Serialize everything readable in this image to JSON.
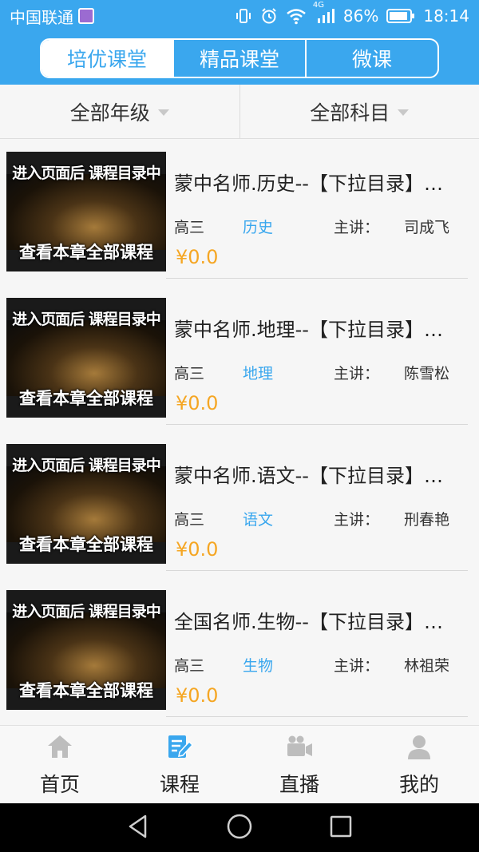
{
  "status_bar": {
    "carrier": "中国联通",
    "network": "4G",
    "battery": "86%",
    "time": "18:14"
  },
  "top_tabs": [
    {
      "label": "培优课堂",
      "active": true
    },
    {
      "label": "精品课堂",
      "active": false
    },
    {
      "label": "微课",
      "active": false
    }
  ],
  "filters": {
    "grade": "全部年级",
    "subject": "全部科目"
  },
  "courses": [
    {
      "thumb_line1": "进入页面后 课程目录中",
      "thumb_line2": "查看本章全部课程",
      "title": "蒙中名师.历史--【下拉目录】点击进入",
      "grade": "高三",
      "subject": "历史",
      "lecturer_label": "主讲：",
      "lecturer": "司成飞",
      "price": "¥0.0"
    },
    {
      "thumb_line1": "进入页面后 课程目录中",
      "thumb_line2": "查看本章全部课程",
      "title": "蒙中名师.地理--【下拉目录】点击进入",
      "grade": "高三",
      "subject": "地理",
      "lecturer_label": "主讲：",
      "lecturer": "陈雪松",
      "price": "¥0.0"
    },
    {
      "thumb_line1": "进入页面后 课程目录中",
      "thumb_line2": "查看本章全部课程",
      "title": "蒙中名师.语文--【下拉目录】点击进入",
      "grade": "高三",
      "subject": "语文",
      "lecturer_label": "主讲：",
      "lecturer": "刑春艳",
      "price": "¥0.0"
    },
    {
      "thumb_line1": "进入页面后 课程目录中",
      "thumb_line2": "查看本章全部课程",
      "title": "全国名师.生物--【下拉目录】点击进入",
      "grade": "高三",
      "subject": "生物",
      "lecturer_label": "主讲：",
      "lecturer": "林祖荣",
      "price": "¥0.0"
    }
  ],
  "bottom_nav": [
    {
      "label": "首页",
      "icon": "home-icon",
      "active": false
    },
    {
      "label": "课程",
      "icon": "course-icon",
      "active": true
    },
    {
      "label": "直播",
      "icon": "live-camera-icon",
      "active": false
    },
    {
      "label": "我的",
      "icon": "user-icon",
      "active": false
    }
  ],
  "colors": {
    "primary": "#3aa7ee",
    "price": "#f5a623",
    "inactive_icon": "#bdbdbd"
  }
}
